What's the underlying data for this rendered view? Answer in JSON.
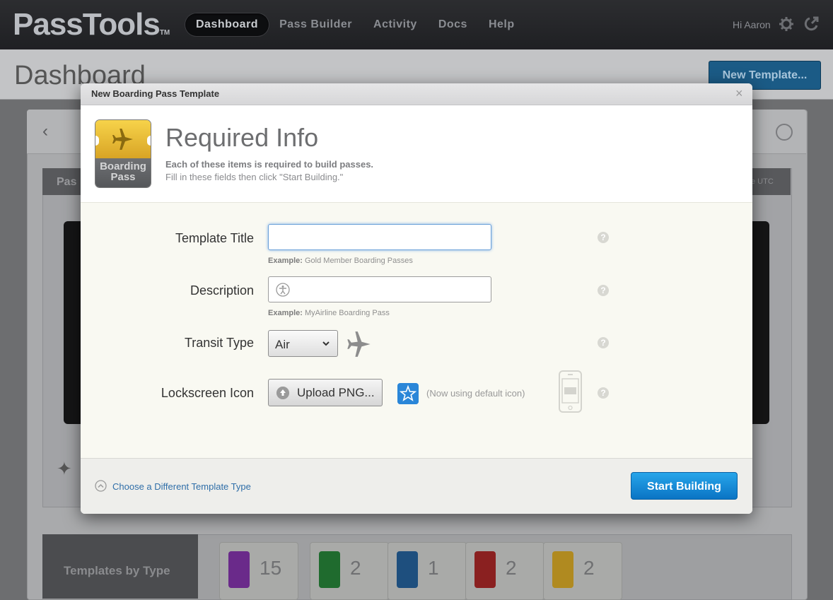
{
  "app": {
    "logo": "PassTools",
    "logo_tm": "TM",
    "nav": [
      "Dashboard",
      "Pass Builder",
      "Activity",
      "Docs",
      "Help"
    ],
    "active_nav": "Dashboard",
    "greeting": "Hi Aaron",
    "settings_icon": "gear-icon",
    "logout_icon": "external-link-icon"
  },
  "page": {
    "title": "Dashboard",
    "new_template_button": "New Template...",
    "panel_label": "Pas",
    "utc_label": "e UTC",
    "templates_by_type": {
      "label": "Templates by Type",
      "items": [
        {
          "type": "coupon",
          "color": "#6a2a8a",
          "count": "15"
        },
        {
          "type": "store-card",
          "color": "#1f6b2e",
          "count": "2"
        },
        {
          "type": "generic",
          "color": "#1e4f7e",
          "count": "1"
        },
        {
          "type": "event-ticket",
          "color": "#8a2020",
          "count": "2"
        },
        {
          "type": "boarding-pass",
          "color": "#b08a20",
          "count": "2"
        }
      ]
    }
  },
  "modal": {
    "title": "New Boarding Pass Template",
    "close_glyph": "×",
    "pass_icon": {
      "line1": "Boarding",
      "line2": "Pass"
    },
    "heading": "Required Info",
    "subtitle_bold": "Each of these items is required to build passes.",
    "subtitle": "Fill in these fields then click \"Start Building.\"",
    "fields": {
      "template_title": {
        "label": "Template Title",
        "value": "",
        "example_prefix": "Example:",
        "example": "Gold Member Boarding Passes"
      },
      "description": {
        "label": "Description",
        "value": "",
        "example_prefix": "Example:",
        "example": "MyAirline Boarding Pass"
      },
      "transit_type": {
        "label": "Transit Type",
        "value": "Air"
      },
      "lockscreen_icon": {
        "label": "Lockscreen Icon",
        "upload_label": "Upload PNG...",
        "status": "(Now using default icon)"
      }
    },
    "help_glyph": "?",
    "choose_link": "Choose a Different Template Type",
    "start_button": "Start Building"
  }
}
